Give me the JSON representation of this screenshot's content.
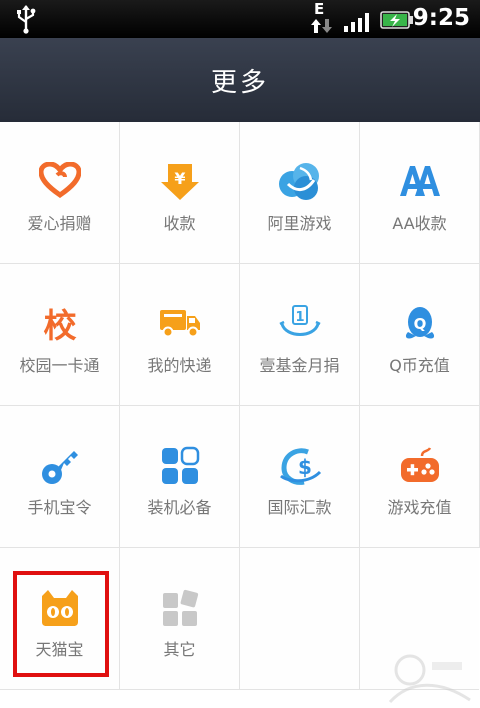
{
  "status_bar": {
    "time": "9:25",
    "network_type": "E",
    "icons": [
      "usb-icon",
      "data-arrows-icon",
      "signal-icon",
      "battery-charging-icon"
    ]
  },
  "header": {
    "title": "更多"
  },
  "grid": {
    "items": [
      {
        "label": "爱心捐赠",
        "icon": "heart-icon",
        "color": "#f26b2b"
      },
      {
        "label": "收款",
        "icon": "yen-download-icon",
        "color": "#f6a01a"
      },
      {
        "label": "阿里游戏",
        "icon": "ali-games-icon",
        "color": "#3aa3e3"
      },
      {
        "label": "AA收款",
        "icon": "aa-icon",
        "color": "#2f8fe0"
      },
      {
        "label": "校园一卡通",
        "icon": "campus-card-icon",
        "color": "#f26b2b"
      },
      {
        "label": "我的快递",
        "icon": "truck-icon",
        "color": "#f6a01a"
      },
      {
        "label": "壹基金月捐",
        "icon": "smile-one-icon",
        "color": "#3aa3e3"
      },
      {
        "label": "Q币充值",
        "icon": "qq-penguin-icon",
        "color": "#2f8fe0"
      },
      {
        "label": "手机宝令",
        "icon": "key-icon",
        "color": "#2f8fe0"
      },
      {
        "label": "装机必备",
        "icon": "apps-grid-icon",
        "color": "#2f8fe0"
      },
      {
        "label": "国际汇款",
        "icon": "global-dollar-icon",
        "color": "#3aa3e3"
      },
      {
        "label": "游戏充值",
        "icon": "gamepad-icon",
        "color": "#f26b2b"
      },
      {
        "label": "天猫宝",
        "icon": "tmall-cat-icon",
        "color": "#f6a01a"
      },
      {
        "label": "其它",
        "icon": "other-squares-icon",
        "color": "#c8c8c8"
      }
    ]
  }
}
